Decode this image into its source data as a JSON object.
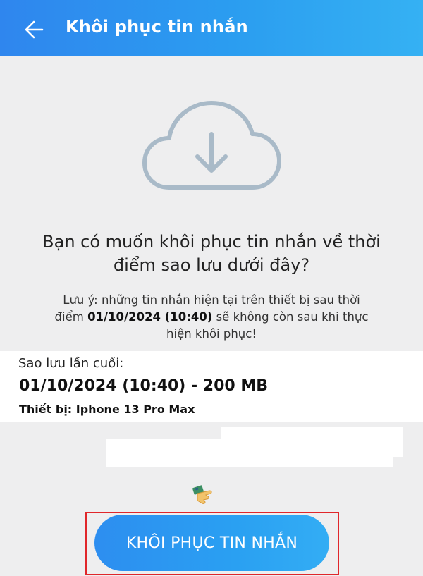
{
  "header": {
    "title": "Khôi phục tin nhắn",
    "back_icon": "arrow-left-icon"
  },
  "illustration": {
    "icon": "cloud-download-icon",
    "color": "#a9bac8"
  },
  "question": {
    "line1": "Bạn có muốn khôi phục tin nhắn về thời",
    "line2": "điểm sao lưu dưới đây?"
  },
  "note": {
    "line1": "Lưu ý: những tin nhắn hiện tại trên thiết bị sau thời",
    "line2_prefix": "điểm ",
    "line2_date": "01/10/2024 (10:40)",
    "line2_suffix": " sẽ không còn sau khi thực",
    "line3": "hiện khôi phục!"
  },
  "backup": {
    "label": "Sao lưu lần cuối:",
    "value": "01/10/2024 (10:40) - 200 MB",
    "device": "Thiết bị: Iphone 13 Pro Max"
  },
  "pointer_icon": "hand-pointer-icon",
  "restore_button": {
    "label": "KHÔI PHỤC TIN NHẮN"
  },
  "colors": {
    "accent": "#2b9df0",
    "highlight": "#e0262a",
    "background": "#eeeeef"
  }
}
